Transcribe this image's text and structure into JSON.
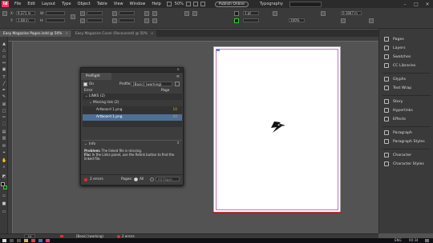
{
  "menubar": {
    "app_icon": "Id",
    "menus": [
      "File",
      "Edit",
      "Layout",
      "Type",
      "Object",
      "Table",
      "View",
      "Window",
      "Help"
    ],
    "zoom": "50%",
    "publish_label": "Publish Online",
    "workspace": "Typography",
    "window_buttons": [
      "–",
      "□",
      "✕"
    ]
  },
  "control": {
    "x_label": "X:",
    "x_value": "9.271 in",
    "y_label": "Y:",
    "y_value": "1.08 in",
    "w_label": "W:",
    "h_label": "H:",
    "stroke_weight": "1 pt",
    "opacity": "100%",
    "dimension": "0.1667 in"
  },
  "tabs": [
    {
      "label": "Easy Magazine Pages.indd @ 50%",
      "active": true
    },
    {
      "label": "Easy Magazine Cover (Recovered) @ 50%",
      "active": false
    }
  ],
  "preflight": {
    "title": "Preflight",
    "on_label": "On",
    "profile_label": "Profile:",
    "profile_value": "[Basic] (working)",
    "error_col": "Error",
    "page_col": "Page",
    "rows": [
      {
        "label": "LINKS (2)",
        "page": ""
      },
      {
        "label": "Missing link (2)",
        "page": ""
      },
      {
        "label": "Artboard 1.png",
        "page": "10"
      },
      {
        "label": "Artboard 1.png",
        "page": "10"
      }
    ],
    "info_label": "Info",
    "problem_label": "Problem:",
    "problem_text": "The linked file is missing.",
    "fix_label": "Fix:",
    "fix_text": "In the Links panel, use the Relink button to find the linked file.",
    "error_count": "2 errors",
    "pages_label": "Pages:",
    "all_label": "All",
    "range_value": "All Pages"
  },
  "right_panel": [
    {
      "label": "Pages",
      "icon": "pages-icon"
    },
    {
      "label": "Layers",
      "icon": "layers-icon"
    },
    {
      "label": "Swatches",
      "icon": "swatches-icon"
    },
    {
      "label": "CC Libraries",
      "icon": "cc-libraries-icon"
    },
    {
      "label": "Glyphs",
      "icon": "glyphs-icon"
    },
    {
      "label": "Text Wrap",
      "icon": "text-wrap-icon"
    },
    {
      "label": "Story",
      "icon": "story-icon"
    },
    {
      "label": "Hyperlinks",
      "icon": "hyperlinks-icon"
    },
    {
      "label": "Effects",
      "icon": "effects-icon"
    },
    {
      "label": "Paragraph",
      "icon": "paragraph-icon"
    },
    {
      "label": "Paragraph Styles",
      "icon": "paragraph-styles-icon"
    },
    {
      "label": "Character",
      "icon": "character-icon"
    },
    {
      "label": "Character Styles",
      "icon": "character-styles-icon"
    }
  ],
  "status": {
    "page_number": "10",
    "profile": "[Basic] (working)",
    "errors": "2 errors"
  },
  "taskbar": {
    "lang": "ENG",
    "time": "00:34"
  },
  "colors": {
    "accent_id": "#ff3366",
    "selection": "#4f6f94",
    "error_red": "#e03030"
  }
}
